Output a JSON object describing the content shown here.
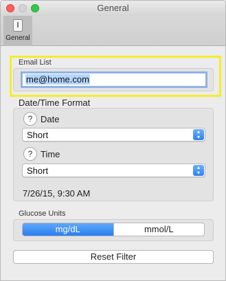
{
  "window": {
    "title": "General",
    "controls": {
      "close_glyph": "",
      "minimize_glyph": "",
      "zoom_glyph": ""
    }
  },
  "toolbar": {
    "items": [
      {
        "label": "General",
        "icon": "general-prefs-icon",
        "selected": true
      }
    ]
  },
  "email_list": {
    "group_label": "Email List",
    "value": "me@home.com",
    "highlight_color": "#f2ee2a"
  },
  "date_time_format": {
    "title": "Date/Time Format",
    "date": {
      "help_glyph": "?",
      "label": "Date",
      "selected": "Short"
    },
    "time": {
      "help_glyph": "?",
      "label": "Time",
      "selected": "Short"
    },
    "preview": "7/26/15, 9:30 AM"
  },
  "glucose_units": {
    "group_label": "Glucose Units",
    "options": [
      "mg/dL",
      "mmol/L"
    ],
    "selected": "mg/dL"
  },
  "actions": {
    "reset_label": "Reset Filter"
  },
  "colors": {
    "accent": "#2f80f0",
    "window_bg": "#ececec"
  }
}
